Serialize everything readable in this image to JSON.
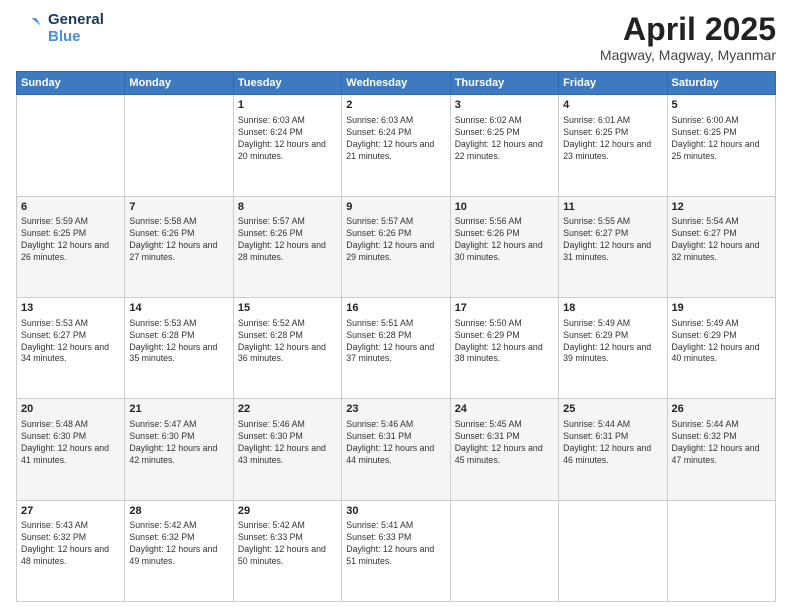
{
  "header": {
    "logo": {
      "line1": "General",
      "line2": "Blue"
    },
    "title": "April 2025",
    "location": "Magway, Magway, Myanmar"
  },
  "days_of_week": [
    "Sunday",
    "Monday",
    "Tuesday",
    "Wednesday",
    "Thursday",
    "Friday",
    "Saturday"
  ],
  "weeks": [
    [
      {
        "day": "",
        "info": ""
      },
      {
        "day": "",
        "info": ""
      },
      {
        "day": "1",
        "info": "Sunrise: 6:03 AM\nSunset: 6:24 PM\nDaylight: 12 hours and 20 minutes."
      },
      {
        "day": "2",
        "info": "Sunrise: 6:03 AM\nSunset: 6:24 PM\nDaylight: 12 hours and 21 minutes."
      },
      {
        "day": "3",
        "info": "Sunrise: 6:02 AM\nSunset: 6:25 PM\nDaylight: 12 hours and 22 minutes."
      },
      {
        "day": "4",
        "info": "Sunrise: 6:01 AM\nSunset: 6:25 PM\nDaylight: 12 hours and 23 minutes."
      },
      {
        "day": "5",
        "info": "Sunrise: 6:00 AM\nSunset: 6:25 PM\nDaylight: 12 hours and 25 minutes."
      }
    ],
    [
      {
        "day": "6",
        "info": "Sunrise: 5:59 AM\nSunset: 6:25 PM\nDaylight: 12 hours and 26 minutes."
      },
      {
        "day": "7",
        "info": "Sunrise: 5:58 AM\nSunset: 6:26 PM\nDaylight: 12 hours and 27 minutes."
      },
      {
        "day": "8",
        "info": "Sunrise: 5:57 AM\nSunset: 6:26 PM\nDaylight: 12 hours and 28 minutes."
      },
      {
        "day": "9",
        "info": "Sunrise: 5:57 AM\nSunset: 6:26 PM\nDaylight: 12 hours and 29 minutes."
      },
      {
        "day": "10",
        "info": "Sunrise: 5:56 AM\nSunset: 6:26 PM\nDaylight: 12 hours and 30 minutes."
      },
      {
        "day": "11",
        "info": "Sunrise: 5:55 AM\nSunset: 6:27 PM\nDaylight: 12 hours and 31 minutes."
      },
      {
        "day": "12",
        "info": "Sunrise: 5:54 AM\nSunset: 6:27 PM\nDaylight: 12 hours and 32 minutes."
      }
    ],
    [
      {
        "day": "13",
        "info": "Sunrise: 5:53 AM\nSunset: 6:27 PM\nDaylight: 12 hours and 34 minutes."
      },
      {
        "day": "14",
        "info": "Sunrise: 5:53 AM\nSunset: 6:28 PM\nDaylight: 12 hours and 35 minutes."
      },
      {
        "day": "15",
        "info": "Sunrise: 5:52 AM\nSunset: 6:28 PM\nDaylight: 12 hours and 36 minutes."
      },
      {
        "day": "16",
        "info": "Sunrise: 5:51 AM\nSunset: 6:28 PM\nDaylight: 12 hours and 37 minutes."
      },
      {
        "day": "17",
        "info": "Sunrise: 5:50 AM\nSunset: 6:29 PM\nDaylight: 12 hours and 38 minutes."
      },
      {
        "day": "18",
        "info": "Sunrise: 5:49 AM\nSunset: 6:29 PM\nDaylight: 12 hours and 39 minutes."
      },
      {
        "day": "19",
        "info": "Sunrise: 5:49 AM\nSunset: 6:29 PM\nDaylight: 12 hours and 40 minutes."
      }
    ],
    [
      {
        "day": "20",
        "info": "Sunrise: 5:48 AM\nSunset: 6:30 PM\nDaylight: 12 hours and 41 minutes."
      },
      {
        "day": "21",
        "info": "Sunrise: 5:47 AM\nSunset: 6:30 PM\nDaylight: 12 hours and 42 minutes."
      },
      {
        "day": "22",
        "info": "Sunrise: 5:46 AM\nSunset: 6:30 PM\nDaylight: 12 hours and 43 minutes."
      },
      {
        "day": "23",
        "info": "Sunrise: 5:46 AM\nSunset: 6:31 PM\nDaylight: 12 hours and 44 minutes."
      },
      {
        "day": "24",
        "info": "Sunrise: 5:45 AM\nSunset: 6:31 PM\nDaylight: 12 hours and 45 minutes."
      },
      {
        "day": "25",
        "info": "Sunrise: 5:44 AM\nSunset: 6:31 PM\nDaylight: 12 hours and 46 minutes."
      },
      {
        "day": "26",
        "info": "Sunrise: 5:44 AM\nSunset: 6:32 PM\nDaylight: 12 hours and 47 minutes."
      }
    ],
    [
      {
        "day": "27",
        "info": "Sunrise: 5:43 AM\nSunset: 6:32 PM\nDaylight: 12 hours and 48 minutes."
      },
      {
        "day": "28",
        "info": "Sunrise: 5:42 AM\nSunset: 6:32 PM\nDaylight: 12 hours and 49 minutes."
      },
      {
        "day": "29",
        "info": "Sunrise: 5:42 AM\nSunset: 6:33 PM\nDaylight: 12 hours and 50 minutes."
      },
      {
        "day": "30",
        "info": "Sunrise: 5:41 AM\nSunset: 6:33 PM\nDaylight: 12 hours and 51 minutes."
      },
      {
        "day": "",
        "info": ""
      },
      {
        "day": "",
        "info": ""
      },
      {
        "day": "",
        "info": ""
      }
    ]
  ]
}
